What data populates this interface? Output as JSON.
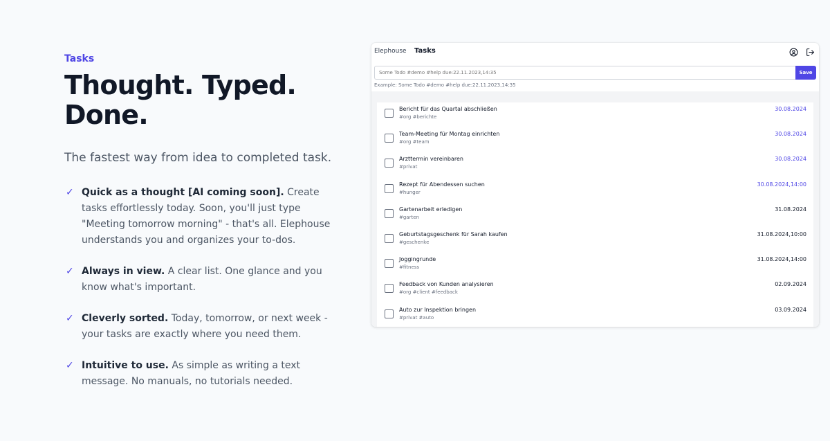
{
  "hero": {
    "eyebrow": "Tasks",
    "headline_line1": "Thought. Typed.",
    "headline_line2": "Done.",
    "tagline": "The fastest way from idea to completed task.",
    "features": [
      {
        "title": "Quick as a thought [AI coming soon].",
        "text": "Create tasks effortlessly today. Soon, you'll just type \"Meeting tomorrow morning\" - that's all. Elephouse understands you and organizes your to-dos."
      },
      {
        "title": "Always in view.",
        "text": "A clear list. One glance and you know what's important."
      },
      {
        "title": "Cleverly sorted.",
        "text": "Today, tomorrow, or next week - your tasks are exactly where you need them."
      },
      {
        "title": "Intuitive to use.",
        "text": "As simple as writing a text message. No manuals, no tutorials needed."
      }
    ]
  },
  "app": {
    "brand": "Elephouse",
    "nav_tasks": "Tasks",
    "input_placeholder": "Some Todo #demo #help due:22.11.2023,14:35",
    "save_label": "Save",
    "example": "Example: Some Todo #demo #help due:22.11.2023,14:35",
    "accent_color": "#4f46e5",
    "tasks": [
      {
        "title": "Bericht für das Quartal abschließen",
        "tags": "#org #berichte",
        "due": "30.08.2024",
        "highlight": true
      },
      {
        "title": "Team-Meeting für Montag einrichten",
        "tags": "#org #team",
        "due": "30.08.2024",
        "highlight": true
      },
      {
        "title": "Arzttermin vereinbaren",
        "tags": "#privat",
        "due": "30.08.2024",
        "highlight": true
      },
      {
        "title": "Rezept für Abendessen suchen",
        "tags": "#hunger",
        "due": "30.08.2024,14:00",
        "highlight": true
      },
      {
        "title": "Gartenarbeit erledigen",
        "tags": "#garten",
        "due": "31.08.2024",
        "highlight": false
      },
      {
        "title": "Geburtstagsgeschenk für Sarah kaufen",
        "tags": "#geschenke",
        "due": "31.08.2024,10:00",
        "highlight": false
      },
      {
        "title": "Joggingrunde",
        "tags": "#fitness",
        "due": "31.08.2024,14:00",
        "highlight": false
      },
      {
        "title": "Feedback von Kunden analysieren",
        "tags": "#org #client #feedback",
        "due": "02.09.2024",
        "highlight": false
      },
      {
        "title": "Auto zur Inspektion bringen",
        "tags": "#privat #auto",
        "due": "03.09.2024",
        "highlight": false
      }
    ]
  }
}
